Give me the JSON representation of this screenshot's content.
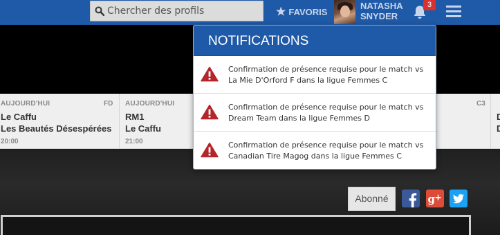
{
  "search": {
    "placeholder": "Chercher des profils"
  },
  "header": {
    "favoris_label": "FAVORIS",
    "user_first": "NATASHA",
    "user_last": "SNYDER",
    "notification_count": "3"
  },
  "ticker": [
    {
      "day": "AUJOURD'HUI",
      "code": "FD",
      "team1": "Le Caffu",
      "team2": "Les Beautés Désespérées",
      "time": "20:00"
    },
    {
      "day": "AUJOURD'HUI",
      "code": "",
      "team1": "RM1",
      "team2": "Le Caffu",
      "time": "21:00"
    },
    {
      "day": "",
      "code": "C3",
      "team1": "",
      "team2": "",
      "time": ""
    },
    {
      "day": "",
      "code": "",
      "team1": "D",
      "team2": "D",
      "time": ""
    }
  ],
  "subscribe_label": "Abonné",
  "social": [
    "facebook-icon",
    "google-plus-icon",
    "twitter-icon"
  ],
  "notifications": {
    "title": "NOTIFICATIONS",
    "items": [
      {
        "message": "Confirmation de présence requise pour le match vs La Mie D'Orford F dans la ligue Femmes C"
      },
      {
        "message": "Confirmation de présence requise pour le match vs Dream Team dans la ligue Femmes D"
      },
      {
        "message": "Confirmation de présence requise pour le match vs Canadian Tire Magog dans la ligue Femmes C"
      }
    ]
  },
  "colors": {
    "brand_blue": "#1f5aa8",
    "warning_red": "#b5262b",
    "badge_red": "#d9322e"
  }
}
